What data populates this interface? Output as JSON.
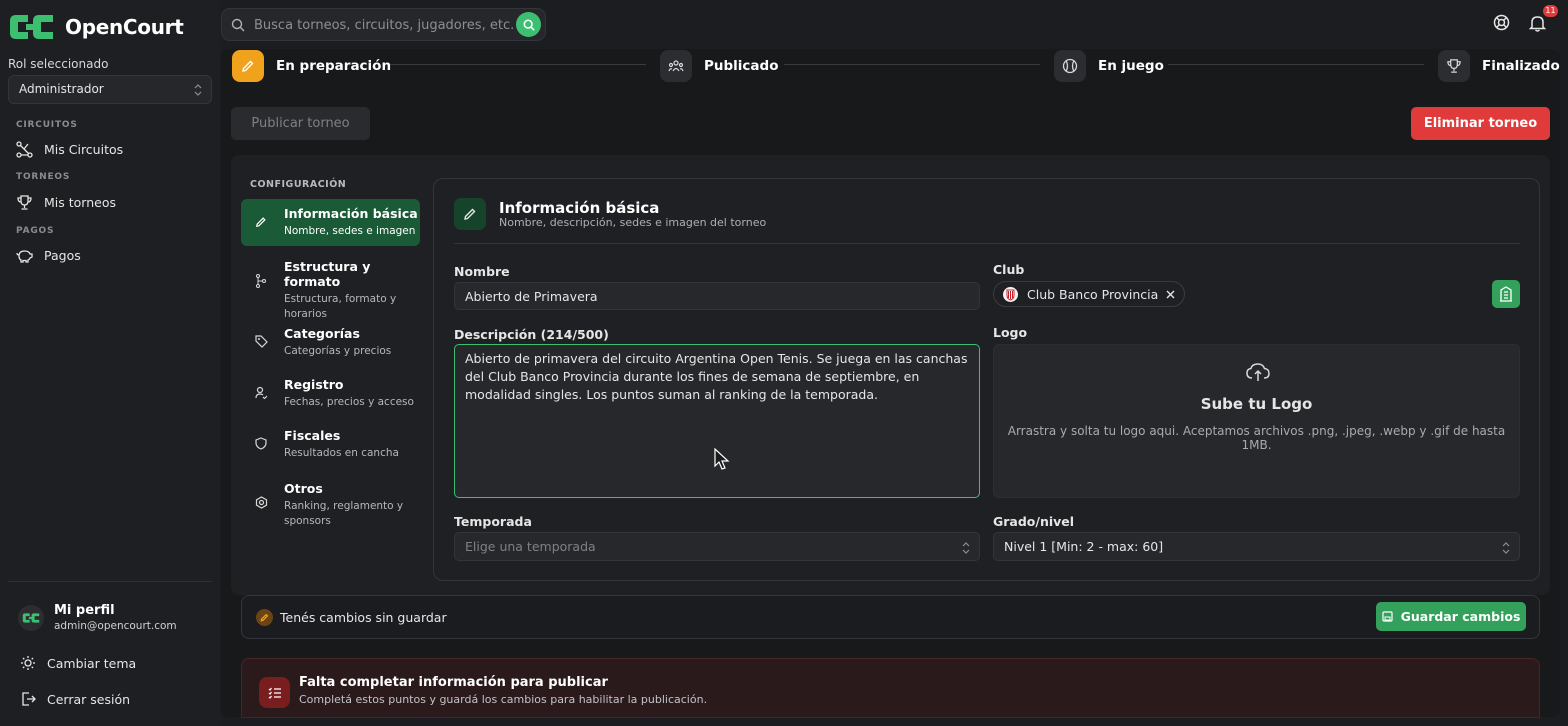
{
  "app": {
    "name": "OpenCourt"
  },
  "sidebar": {
    "role_label": "Rol seleccionado",
    "role_value": "Administrador",
    "sections": [
      {
        "title": "CIRCUITOS",
        "items": [
          {
            "label": "Mis Circuitos",
            "icon": "circuit-icon"
          }
        ]
      },
      {
        "title": "TORNEOS",
        "items": [
          {
            "label": "Mis torneos",
            "icon": "trophy-icon"
          }
        ]
      },
      {
        "title": "PAGOS",
        "items": [
          {
            "label": "Pagos",
            "icon": "piggy-bank-icon"
          }
        ]
      }
    ],
    "profile": {
      "name": "Mi perfil",
      "email": "admin@opencourt.com"
    },
    "theme_label": "Cambiar tema",
    "logout_label": "Cerrar sesión"
  },
  "topbar": {
    "search_placeholder": "Busca torneos, circuitos, jugadores, etc.",
    "notifications_count": "11"
  },
  "steps": [
    {
      "label": "En preparación",
      "icon": "pencil-icon",
      "active": true
    },
    {
      "label": "Publicado",
      "icon": "people-icon",
      "active": false
    },
    {
      "label": "En juego",
      "icon": "tennis-ball-icon",
      "active": false
    },
    {
      "label": "Finalizado",
      "icon": "trophy-icon",
      "active": false
    }
  ],
  "actions": {
    "publish": "Publicar torneo",
    "delete": "Eliminar torneo"
  },
  "config": {
    "title": "CONFIGURACIÓN",
    "nav": [
      {
        "title": "Información básica",
        "sub": "Nombre, sedes e imagen",
        "active": true
      },
      {
        "title": "Estructura y formato",
        "sub": "Estructura, formato y horarios"
      },
      {
        "title": "Categorías",
        "sub": "Categorías y precios"
      },
      {
        "title": "Registro",
        "sub": "Fechas, precios y acceso"
      },
      {
        "title": "Fiscales",
        "sub": "Resultados en cancha"
      },
      {
        "title": "Otros",
        "sub": "Ranking, reglamento y sponsors"
      }
    ]
  },
  "form": {
    "title": "Información básica",
    "subtitle": "Nombre, descripción, sedes e imagen del torneo",
    "name_label": "Nombre",
    "name_value": "Abierto de Primavera",
    "club_label": "Club",
    "club_value": "Club Banco Provincia",
    "description_label": "Descripción (214/500)",
    "description_value": "Abierto de primavera del circuito Argentina Open Tenis. Se juega en las canchas del Club Banco Provincia durante los fines de semana de septiembre, en modalidad singles. Los puntos suman al ranking de la temporada.",
    "logo_label": "Logo",
    "logo_title": "Sube tu Logo",
    "logo_hint": "Arrastra y solta tu logo aqui. Aceptamos archivos .png, .jpeg, .webp y .gif de hasta 1MB.",
    "season_label": "Temporada",
    "season_placeholder": "Elige una temporada",
    "level_label": "Grado/nivel",
    "level_value": "Nivel 1 [Min: 2 - max: 60]"
  },
  "unsaved": {
    "text": "Tenés cambios sin guardar",
    "save_label": "Guardar cambios"
  },
  "alert": {
    "title": "Falta completar información para publicar",
    "sub": "Completá estos puntos y guardá los cambios para habilitar la publicación."
  },
  "colors": {
    "accent": "#3dbf72",
    "active_step": "#f0a21c",
    "danger": "#e03a3a",
    "active_nav": "#1a5a36"
  }
}
